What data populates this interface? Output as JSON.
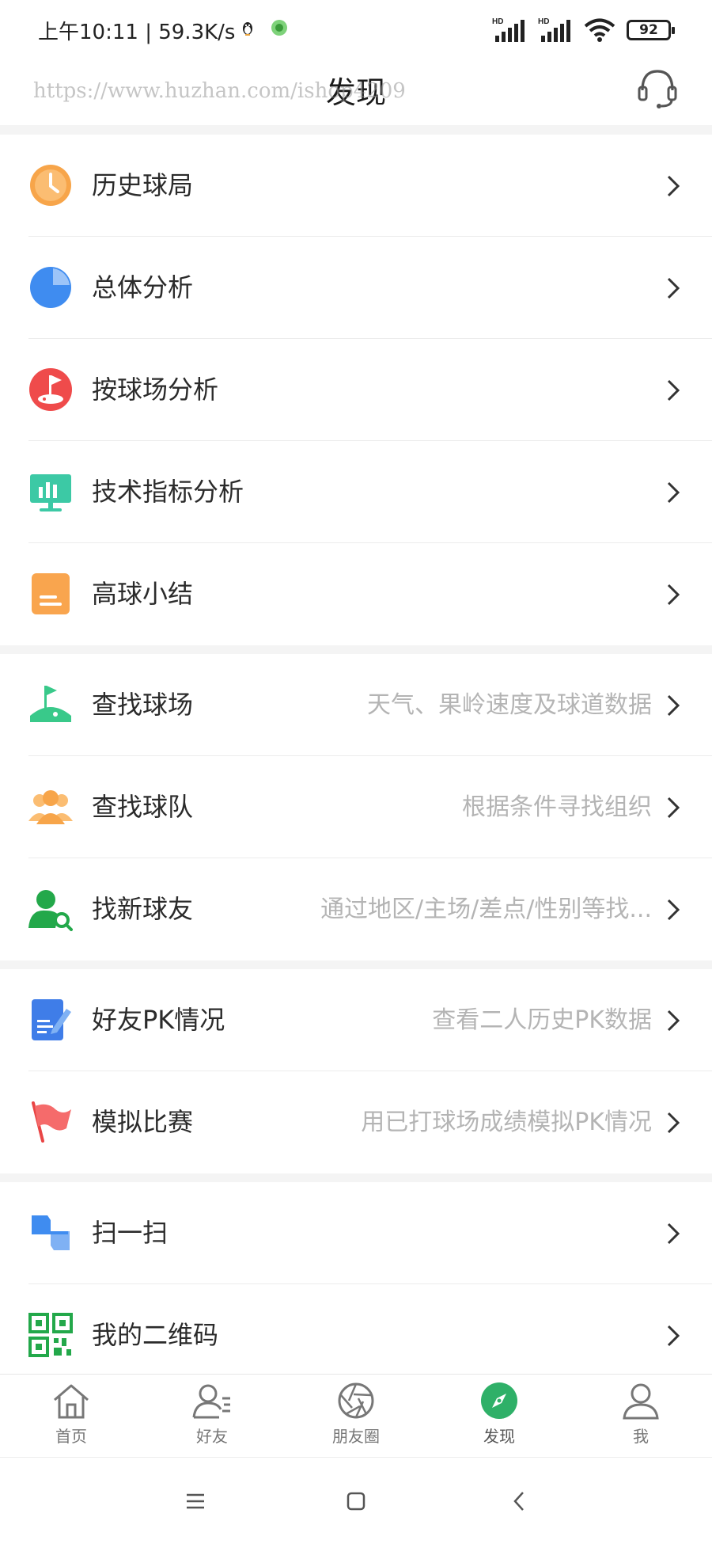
{
  "status_bar": {
    "time": "上午10:11 | 59.3K/s",
    "battery": "92",
    "signal1_label": "HD",
    "signal2_label": "HD"
  },
  "nav": {
    "title": "发现",
    "watermark": "https://www.huzhan.com/ishop4209"
  },
  "groups": [
    {
      "items": [
        {
          "label": "历史球局",
          "sub": "",
          "icon": "clock-icon",
          "color": "#f7a54a"
        },
        {
          "label": "总体分析",
          "sub": "",
          "icon": "pie-chart-icon",
          "color": "#3f8cf0"
        },
        {
          "label": "按球场分析",
          "sub": "",
          "icon": "golf-course-flag-icon",
          "color": "#ef4b4b"
        },
        {
          "label": "技术指标分析",
          "sub": "",
          "icon": "monitor-bar-chart-icon",
          "color": "#3cc9a5"
        },
        {
          "label": "高球小结",
          "sub": "",
          "icon": "document-icon",
          "color": "#f9a54e"
        }
      ]
    },
    {
      "items": [
        {
          "label": "查找球场",
          "sub": "天气、果岭速度及球道数据",
          "icon": "golf-green-icon",
          "color": "#39c98a"
        },
        {
          "label": "查找球队",
          "sub": "根据条件寻找组织",
          "icon": "team-icon",
          "color": "#f7a54a"
        },
        {
          "label": "找新球友",
          "sub": "通过地区/主场/差点/性别等找...",
          "icon": "user-search-icon",
          "color": "#23a84a"
        }
      ]
    },
    {
      "items": [
        {
          "label": "好友PK情况",
          "sub": "查看二人历史PK数据",
          "icon": "edit-doc-icon",
          "color": "#3f7de8"
        },
        {
          "label": "模拟比赛",
          "sub": "用已打球场成绩模拟PK情况",
          "icon": "red-flag-icon",
          "color": "#f05a5a"
        }
      ]
    },
    {
      "items": [
        {
          "label": "扫一扫",
          "sub": "",
          "icon": "scan-icon",
          "color": "#3f8cf0"
        },
        {
          "label": "我的二维码",
          "sub": "",
          "icon": "qr-code-icon",
          "color": "#23a84a"
        }
      ]
    }
  ],
  "tabs": [
    {
      "label": "首页",
      "icon": "home-icon",
      "active": false
    },
    {
      "label": "好友",
      "icon": "friends-icon",
      "active": false
    },
    {
      "label": "朋友圈",
      "icon": "shutter-icon",
      "active": false
    },
    {
      "label": "发现",
      "icon": "compass-icon",
      "active": true
    },
    {
      "label": "我",
      "icon": "person-icon",
      "active": false
    }
  ],
  "colors": {
    "accent": "#2fb068",
    "chevron": "#333333",
    "subtext": "#b4b4b4"
  }
}
